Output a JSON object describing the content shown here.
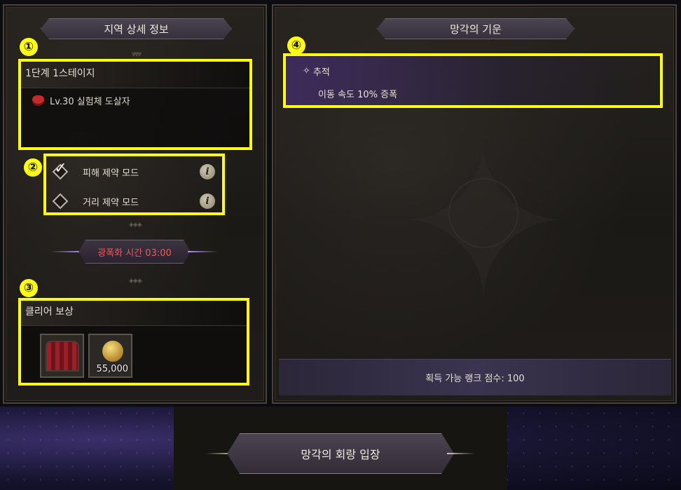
{
  "left_panel": {
    "title": "지역 상세 정보",
    "stage": {
      "badge": "①",
      "title": "1단계 1스테이지",
      "monster": "Lv.30 실험체 도살자",
      "monster_icon": "demon-skull-icon"
    },
    "modes": {
      "badge": "②",
      "items": [
        {
          "label": "피해 제약 모드",
          "checked": true,
          "info": "i"
        },
        {
          "label": "거리 제약 모드",
          "checked": false,
          "info": "i"
        }
      ]
    },
    "timer": "광폭화 시간 03:00",
    "reward": {
      "badge": "③",
      "title": "클리어 보상",
      "items": [
        {
          "icon": "treasure-chest-icon",
          "count": ""
        },
        {
          "icon": "gold-coin-icon",
          "count": "55,000"
        }
      ]
    }
  },
  "right_panel": {
    "title": "망각의 기운",
    "effect": {
      "badge": "④",
      "name": "추적",
      "description": "이동 속도 10% 증폭"
    },
    "rank_score": "획득 가능 랭크 점수: 100"
  },
  "enter_button": "망각의 회랑 입장",
  "colors": {
    "highlight": "#ffff14",
    "timer_text": "#e85a5a",
    "accent_purple": "#b58cff"
  }
}
